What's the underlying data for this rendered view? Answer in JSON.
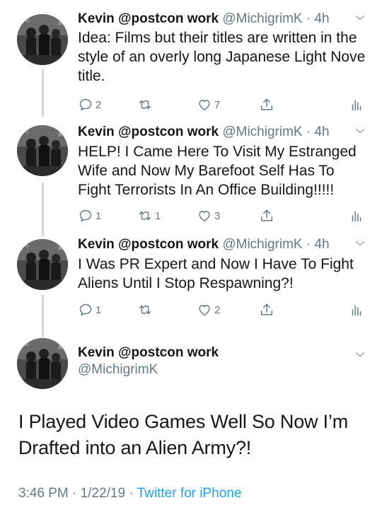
{
  "tweets": [
    {
      "name": "Kevin @postcon work",
      "handle": "@MichigrimK",
      "separator": "·",
      "time": "4h",
      "text": "Idea: Films but their titles are written in the style of an overly long Japanese Light Nove title.",
      "replies": "2",
      "retweets": "",
      "likes": "7"
    },
    {
      "name": "Kevin @postcon work",
      "handle": "@MichigrimK",
      "separator": "·",
      "time": "4h",
      "text": "HELP! I Came Here To Visit My Estranged Wife and Now My Barefoot Self Has To Fight Terrorists In An Office Building!!!!!",
      "replies": "1",
      "retweets": "1",
      "likes": "3"
    },
    {
      "name": "Kevin @postcon work",
      "handle": "@MichigrimK",
      "separator": "·",
      "time": "4h",
      "text": "I Was PR Expert and Now I Have To Fight Aliens Until I Stop Respawning?!",
      "replies": "1",
      "retweets": "",
      "likes": "2"
    }
  ],
  "main_tweet": {
    "name": "Kevin @postcon work",
    "handle": "@MichigrimK",
    "text": "I Played Video Games Well So Now I’m Drafted into an Alien Army?!",
    "time": "3:46 PM",
    "date": "1/22/19",
    "separator": "·",
    "source": "Twitter for iPhone"
  },
  "icons": {
    "reply": "reply-icon",
    "retweet": "retweet-icon",
    "like": "heart-icon",
    "share": "share-icon",
    "analytics": "analytics-icon",
    "caret": "chevron-down-icon"
  },
  "colors": {
    "text": "#14171a",
    "secondary": "#657786",
    "link": "#1da1f2",
    "thread_line": "#cfd9de"
  }
}
